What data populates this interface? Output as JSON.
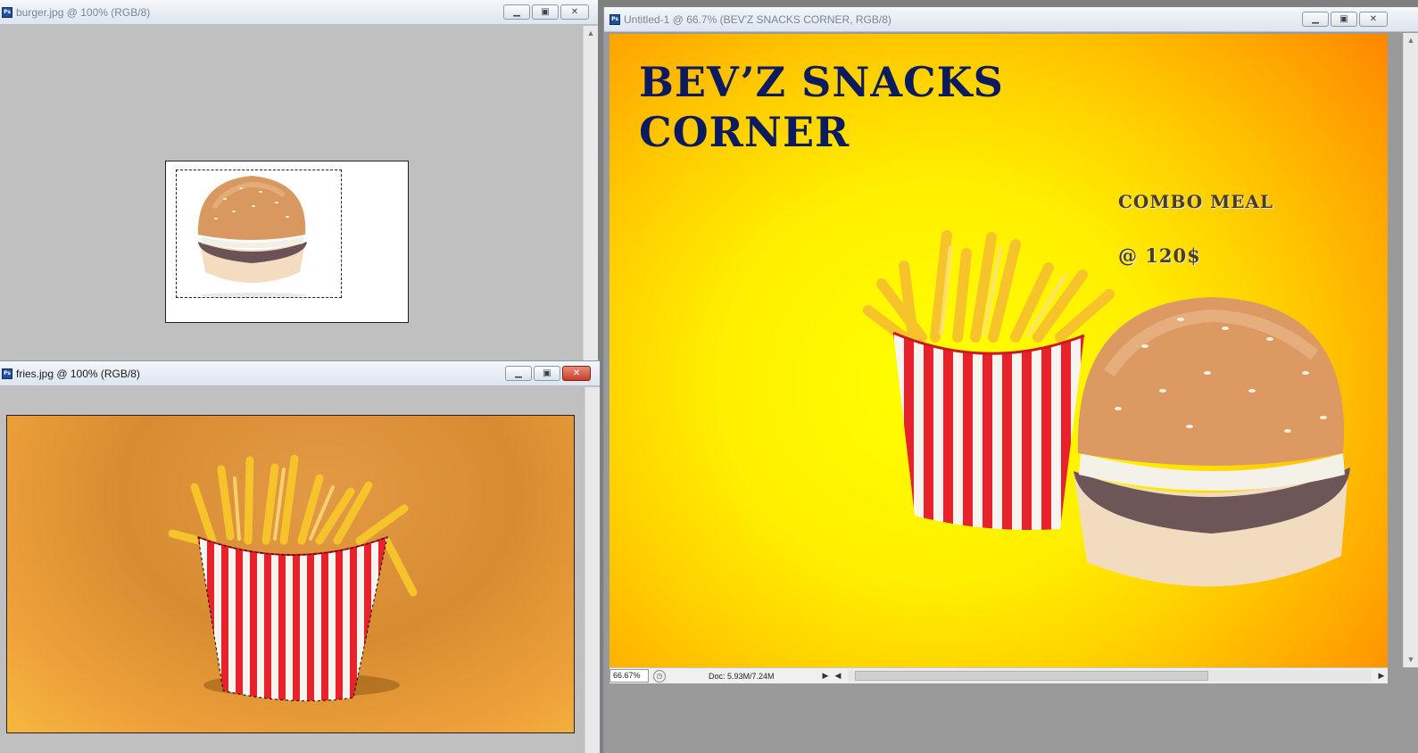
{
  "windows": {
    "burger": {
      "title": "burger.jpg @ 100% (RGB/8)"
    },
    "fries": {
      "title": "fries.jpg @ 100% (RGB/8)"
    },
    "main": {
      "title": "Untitled-1 @ 66.7% (BEV'Z SNACKS CORNER, RGB/8)",
      "headline_line1": "BEV’Z SNACKS",
      "headline_line2": "CORNER",
      "combo": "COMBO MEAL",
      "price": "@ 120$",
      "status": {
        "zoom": "66.67%",
        "doc": "Doc: 5.93M/7.24M"
      }
    }
  },
  "icons": {
    "app": "photoshop-doc-icon",
    "minimize": "minimize-icon",
    "restore": "restore-icon",
    "close": "close-icon"
  },
  "colors": {
    "headline": "#0c1a5e",
    "poster_center": "#ffff00",
    "poster_edge": "#ff7a00",
    "close_active": "#c6402a"
  }
}
